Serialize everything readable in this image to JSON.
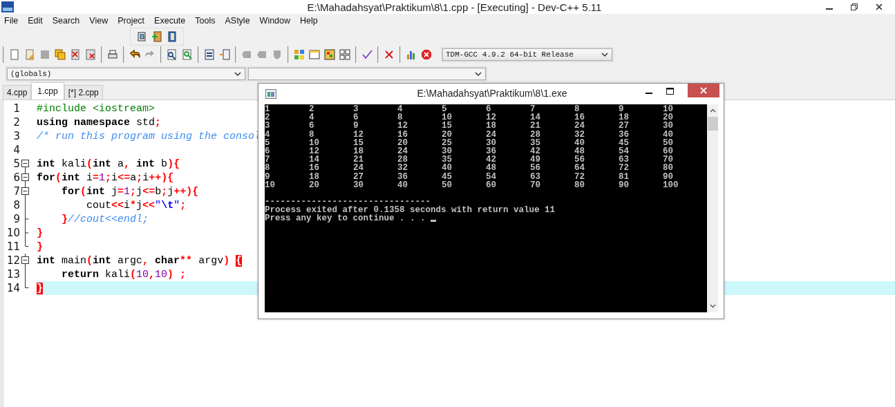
{
  "window": {
    "title": "E:\\Mahadahsyat\\Praktikum\\8\\1.cpp - [Executing] - Dev-C++ 5.11"
  },
  "menu": [
    "File",
    "Edit",
    "Search",
    "View",
    "Project",
    "Execute",
    "Tools",
    "AStyle",
    "Window",
    "Help"
  ],
  "toolbar_top": [
    {
      "disabled": false
    },
    {
      "disabled": false
    },
    {
      "disabled": false
    }
  ],
  "toolbar_main": [
    [
      {
        "disabled": false
      },
      {
        "disabled": false
      },
      {
        "disabled": true
      },
      {
        "disabled": false
      },
      {
        "disabled": false
      },
      {
        "disabled": false
      }
    ],
    [
      {
        "disabled": false
      }
    ],
    [
      {
        "disabled": false
      },
      {
        "disabled": true
      }
    ],
    [
      {
        "disabled": false
      },
      {
        "disabled": false
      }
    ],
    [
      {
        "disabled": false
      },
      {
        "disabled": false
      }
    ],
    [
      {
        "disabled": true
      },
      {
        "disabled": true
      },
      {
        "disabled": true
      }
    ],
    [
      {
        "disabled": false
      },
      {
        "disabled": false
      },
      {
        "disabled": false
      },
      {
        "disabled": false
      }
    ],
    [
      {
        "disabled": false
      }
    ],
    [
      {
        "disabled": false
      }
    ],
    [
      {
        "disabled": false
      },
      {
        "disabled": false
      }
    ]
  ],
  "compiler_select": {
    "value": "TDM-GCC 4.9.2 64-bit Release"
  },
  "scope_select": {
    "value": "(globals)"
  },
  "tabs": [
    {
      "label": "4.cpp",
      "selected": false
    },
    {
      "label": "1.cpp",
      "selected": true
    },
    {
      "label": "[*] 2.cpp",
      "selected": false
    }
  ],
  "editor": {
    "lines": [
      {
        "number": "1",
        "kind": "plain",
        "current": false,
        "tokens": [
          {
            "kind": "pp",
            "text": "#include <iostream>"
          }
        ]
      },
      {
        "number": "2",
        "kind": "plain",
        "current": false,
        "tokens": [
          {
            "kind": "kw",
            "text": "using"
          },
          {
            "kind": "kw",
            "text": " namespace"
          },
          {
            "kind": "id",
            "text": " std"
          },
          {
            "kind": "sym",
            "text": ";"
          }
        ]
      },
      {
        "number": "3",
        "kind": "plain",
        "current": false,
        "tokens": [
          {
            "kind": "cm",
            "text": "/* run this program using the consol"
          }
        ]
      },
      {
        "number": "4",
        "kind": "plain",
        "current": false
      },
      {
        "number": "5",
        "kind": "foldstart",
        "current": false,
        "tokens": [
          {
            "kind": "kw",
            "text": "int"
          },
          {
            "kind": "id",
            "text": " kali"
          },
          {
            "kind": "sym",
            "text": "("
          },
          {
            "kind": "kw",
            "text": "int"
          },
          {
            "kind": "id",
            "text": " a"
          },
          {
            "kind": "sym",
            "text": ","
          },
          {
            "kind": "kw",
            "text": " int"
          },
          {
            "kind": "id",
            "text": " b"
          },
          {
            "kind": "sym",
            "text": "){"
          }
        ]
      },
      {
        "number": "6",
        "kind": "foldstart",
        "current": false,
        "tokens": [
          {
            "kind": "kw",
            "text": "for"
          },
          {
            "kind": "sym",
            "text": "("
          },
          {
            "kind": "kw",
            "text": "int"
          },
          {
            "kind": "id",
            "text": " i"
          },
          {
            "kind": "sym",
            "text": "="
          },
          {
            "kind": "num",
            "text": "1"
          },
          {
            "kind": "sym",
            "text": ";"
          },
          {
            "kind": "id",
            "text": "i"
          },
          {
            "kind": "sym",
            "text": "<="
          },
          {
            "kind": "id",
            "text": "a"
          },
          {
            "kind": "sym",
            "text": ";"
          },
          {
            "kind": "id",
            "text": "i"
          },
          {
            "kind": "sym",
            "text": "++){"
          }
        ]
      },
      {
        "number": "7",
        "kind": "foldstart",
        "current": false,
        "tokens": [
          {
            "kind": "kw",
            "text": "    for"
          },
          {
            "kind": "sym",
            "text": "("
          },
          {
            "kind": "kw",
            "text": "int"
          },
          {
            "kind": "id",
            "text": " j"
          },
          {
            "kind": "sym",
            "text": "="
          },
          {
            "kind": "num",
            "text": "1"
          },
          {
            "kind": "sym",
            "text": ";"
          },
          {
            "kind": "id",
            "text": "j"
          },
          {
            "kind": "sym",
            "text": "<="
          },
          {
            "kind": "id",
            "text": "b"
          },
          {
            "kind": "sym",
            "text": ";"
          },
          {
            "kind": "id",
            "text": "j"
          },
          {
            "kind": "sym",
            "text": "++){"
          }
        ]
      },
      {
        "number": "8",
        "kind": "foldbody",
        "current": false,
        "tokens": [
          {
            "kind": "id",
            "text": "        cout"
          },
          {
            "kind": "sym",
            "text": "<<"
          },
          {
            "kind": "id",
            "text": "i"
          },
          {
            "kind": "sym",
            "text": "*"
          },
          {
            "kind": "id",
            "text": "j"
          },
          {
            "kind": "sym",
            "text": "<<"
          },
          {
            "kind": "str",
            "text": "\""
          },
          {
            "kind": "esc",
            "text": "\\t"
          },
          {
            "kind": "str",
            "text": "\""
          },
          {
            "kind": "sym",
            "text": ";"
          }
        ]
      },
      {
        "number": "9",
        "kind": "foldend",
        "current": false,
        "tokens": [
          {
            "kind": "sym",
            "text": "    }"
          },
          {
            "kind": "cm",
            "text": "//cout<<endl;"
          }
        ]
      },
      {
        "number": "10",
        "kind": "foldend",
        "current": false,
        "tokens": [
          {
            "kind": "sym",
            "text": "}"
          }
        ]
      },
      {
        "number": "11",
        "kind": "foldlast",
        "current": false,
        "tokens": [
          {
            "kind": "sym",
            "text": "}"
          }
        ]
      },
      {
        "number": "12",
        "kind": "foldstart",
        "current": false,
        "tokens": [
          {
            "kind": "kw",
            "text": "int"
          },
          {
            "kind": "id",
            "text": " main"
          },
          {
            "kind": "sym",
            "text": "("
          },
          {
            "kind": "kw",
            "text": "int"
          },
          {
            "kind": "id",
            "text": " argc"
          },
          {
            "kind": "sym",
            "text": ","
          },
          {
            "kind": "kw",
            "text": " char"
          },
          {
            "kind": "sym",
            "text": "**"
          },
          {
            "kind": "id",
            "text": " argv"
          },
          {
            "kind": "sym",
            "text": ") "
          },
          {
            "kind": "match",
            "text": "{"
          }
        ]
      },
      {
        "number": "13",
        "kind": "foldbody",
        "current": false,
        "tokens": [
          {
            "kind": "kw",
            "text": "    return"
          },
          {
            "kind": "id",
            "text": " kali"
          },
          {
            "kind": "sym",
            "text": "("
          },
          {
            "kind": "num",
            "text": "10"
          },
          {
            "kind": "sym",
            "text": ","
          },
          {
            "kind": "num",
            "text": "10"
          },
          {
            "kind": "sym",
            "text": ") ;"
          }
        ]
      },
      {
        "number": "14",
        "kind": "foldlast",
        "current": true,
        "tokens": [
          {
            "kind": "match",
            "text": "}"
          }
        ]
      }
    ]
  },
  "console": {
    "title": "E:\\Mahadahsyat\\Praktikum\\8\\1.exe",
    "rows": [
      [
        "1",
        "2",
        "3",
        "4",
        "5",
        "6",
        "7",
        "8",
        "9",
        "10"
      ],
      [
        "2",
        "4",
        "6",
        "8",
        "10",
        "12",
        "14",
        "16",
        "18",
        "20"
      ],
      [
        "3",
        "6",
        "9",
        "12",
        "15",
        "18",
        "21",
        "24",
        "27",
        "30"
      ],
      [
        "4",
        "8",
        "12",
        "16",
        "20",
        "24",
        "28",
        "32",
        "36",
        "40"
      ],
      [
        "5",
        "10",
        "15",
        "20",
        "25",
        "30",
        "35",
        "40",
        "45",
        "50"
      ],
      [
        "6",
        "12",
        "18",
        "24",
        "30",
        "36",
        "42",
        "48",
        "54",
        "60"
      ],
      [
        "7",
        "14",
        "21",
        "28",
        "35",
        "42",
        "49",
        "56",
        "63",
        "70"
      ],
      [
        "8",
        "16",
        "24",
        "32",
        "40",
        "48",
        "56",
        "64",
        "72",
        "80"
      ],
      [
        "9",
        "18",
        "27",
        "36",
        "45",
        "54",
        "63",
        "72",
        "81",
        "90"
      ],
      [
        "10",
        "20",
        "30",
        "40",
        "50",
        "60",
        "70",
        "80",
        "90",
        "100"
      ]
    ],
    "separator": "--------------------------------",
    "exit_message": "Process exited after 0.1358 seconds with return value 11",
    "prompt": "Press any key to continue . . . "
  }
}
